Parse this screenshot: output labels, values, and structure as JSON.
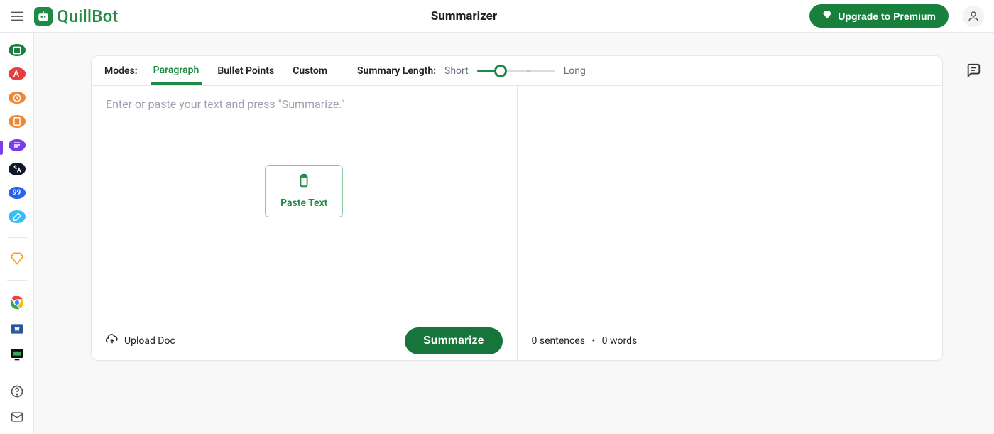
{
  "header": {
    "brand": "QuillBot",
    "page_title": "Summarizer",
    "upgrade_label": "Upgrade to Premium"
  },
  "sidebar": {
    "tools": [
      {
        "name": "paraphraser"
      },
      {
        "name": "grammar-checker"
      },
      {
        "name": "plagiarism-checker"
      },
      {
        "name": "co-writer"
      },
      {
        "name": "summarizer",
        "active": true
      },
      {
        "name": "translator"
      },
      {
        "name": "citation-generator"
      },
      {
        "name": "extensions"
      }
    ]
  },
  "modes": {
    "label": "Modes:",
    "tabs": [
      "Paragraph",
      "Bullet Points",
      "Custom"
    ],
    "active_index": 0
  },
  "summary_length": {
    "label": "Summary Length:",
    "short_label": "Short",
    "long_label": "Long"
  },
  "input": {
    "placeholder": "Enter or paste your text and press \"Summarize.\"",
    "paste_label": "Paste Text",
    "upload_label": "Upload Doc",
    "summarize_label": "Summarize"
  },
  "output": {
    "sentences_count": 0,
    "sentences_label": "sentences",
    "words_count": 0,
    "words_label": "words"
  }
}
